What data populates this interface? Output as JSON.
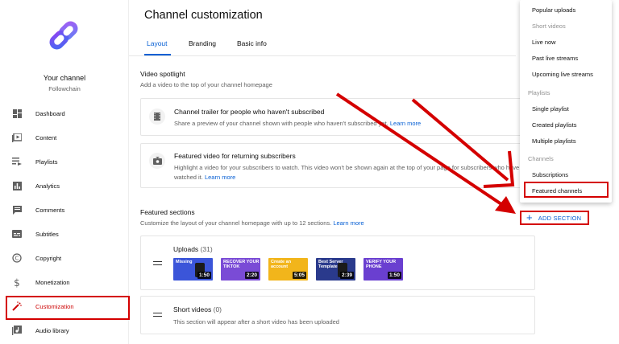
{
  "sidebar": {
    "channel_title": "Your channel",
    "channel_name": "Followchain",
    "items": [
      {
        "label": "Dashboard",
        "icon": "dashboard-icon"
      },
      {
        "label": "Content",
        "icon": "content-icon"
      },
      {
        "label": "Playlists",
        "icon": "playlists-icon"
      },
      {
        "label": "Analytics",
        "icon": "analytics-icon"
      },
      {
        "label": "Comments",
        "icon": "comments-icon"
      },
      {
        "label": "Subtitles",
        "icon": "subtitles-icon"
      },
      {
        "label": "Copyright",
        "icon": "copyright-icon"
      },
      {
        "label": "Monetization",
        "icon": "monetization-icon"
      },
      {
        "label": "Customization",
        "icon": "customization-icon",
        "active": true
      },
      {
        "label": "Audio library",
        "icon": "audio-library-icon"
      }
    ]
  },
  "main": {
    "title": "Channel customization",
    "tabs": [
      {
        "label": "Layout",
        "active": true
      },
      {
        "label": "Branding"
      },
      {
        "label": "Basic info"
      }
    ],
    "spotlight": {
      "title": "Video spotlight",
      "desc": "Add a video to the top of your channel homepage",
      "trailer": {
        "title": "Channel trailer for people who haven't subscribed",
        "desc": "Share a preview of your channel shown with people who haven't subscribed yet.",
        "link": "Learn more"
      },
      "featured": {
        "title": "Featured video for returning subscribers",
        "desc": "Highlight a video for your subscribers to watch. This video won't be shown again at the top of your page for subscribers who have watched it.",
        "link": "Learn more"
      }
    },
    "featured_sections": {
      "title": "Featured sections",
      "desc": "Customize the layout of your channel homepage with up to 12 sections.",
      "link": "Learn more",
      "add_button": "ADD SECTION",
      "uploads": {
        "title": "Uploads",
        "count": "(31)",
        "thumbs": [
          {
            "caption": "Missing",
            "duration": "1:50",
            "color": "#3b55d9"
          },
          {
            "caption": "RECOVER YOUR TIKTOK",
            "duration": "2:20",
            "color": "#7a4bd6"
          },
          {
            "caption": "Create an account",
            "duration": "5:05",
            "color": "#f2b51b"
          },
          {
            "caption": "Best Server Templates",
            "duration": "2:39",
            "color": "#2a3a8c"
          },
          {
            "caption": "VERIFY YOUR PHONE",
            "duration": "1:50",
            "color": "#6a3fd0"
          }
        ]
      },
      "short_videos": {
        "title": "Short videos",
        "count": "(0)",
        "desc": "This section will appear after a short video has been uploaded"
      }
    }
  },
  "menu": {
    "items": [
      {
        "label": "Popular uploads",
        "type": "item"
      },
      {
        "label": "Short videos",
        "type": "disabled"
      },
      {
        "label": "Live now",
        "type": "item"
      },
      {
        "label": "Past live streams",
        "type": "item"
      },
      {
        "label": "Upcoming live streams",
        "type": "item"
      },
      {
        "label": "Playlists",
        "type": "group"
      },
      {
        "label": "Single playlist",
        "type": "item"
      },
      {
        "label": "Created playlists",
        "type": "item"
      },
      {
        "label": "Multiple playlists",
        "type": "item"
      },
      {
        "label": "Channels",
        "type": "group"
      },
      {
        "label": "Subscriptions",
        "type": "item"
      },
      {
        "label": "Featured channels",
        "type": "item",
        "highlighted": true
      }
    ]
  },
  "colors": {
    "accent": "#065fd4",
    "annotation": "#d40000",
    "active": "#cc0000"
  }
}
